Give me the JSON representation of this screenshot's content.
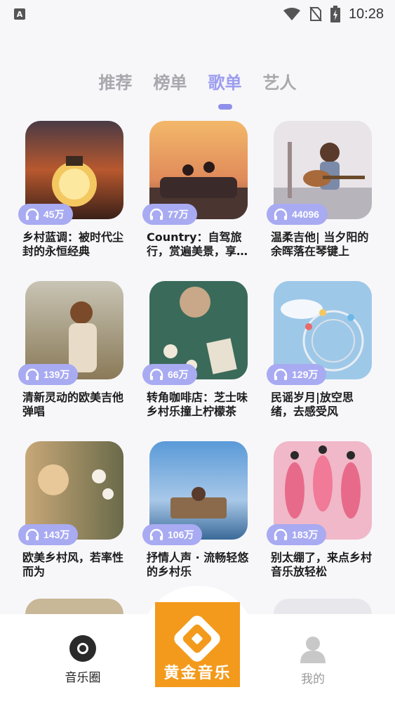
{
  "status_bar": {
    "time": "10:28",
    "left_badge": "A"
  },
  "tabs": [
    {
      "label": "推荐",
      "active": false
    },
    {
      "label": "榜单",
      "active": false
    },
    {
      "label": "歌单",
      "active": true
    },
    {
      "label": "艺人",
      "active": false
    }
  ],
  "playlists": [
    {
      "plays": "45万",
      "title": "乡村蓝调：被时代尘封的永恒经典",
      "cover": "lantern-sunset"
    },
    {
      "plays": "77万",
      "title": "Country：自驾旅行，赏遍美景，享受自由",
      "cover": "roadtrip"
    },
    {
      "plays": "44096",
      "title": "温柔吉他| 当夕阳的余晖落在琴键上",
      "cover": "guitar-girl"
    },
    {
      "plays": "139万",
      "title": "清新灵动的欧美吉他弹唱",
      "cover": "field-girl"
    },
    {
      "plays": "66万",
      "title": "转角咖啡店：芝士味乡村乐撞上柠檬茶",
      "cover": "cafe-table"
    },
    {
      "plays": "129万",
      "title": "民谣岁月|放空思绪，去感受风",
      "cover": "ferris-wheel"
    },
    {
      "plays": "143万",
      "title": "欧美乡村风，若率性而为",
      "cover": "dandelion"
    },
    {
      "plays": "106万",
      "title": "抒情人声 · 流畅轻悠的乡村乐",
      "cover": "sea-chair"
    },
    {
      "plays": "183万",
      "title": "别太绷了，来点乡村音乐放轻松",
      "cover": "flamingos"
    }
  ],
  "bottom_nav": {
    "left_label": "音乐圈",
    "center_label": "黄金音乐",
    "right_label": "我的"
  },
  "colors": {
    "accent": "#9d9df0",
    "badge": "#a8aaf2",
    "logo_orange": "#f39a1c"
  }
}
